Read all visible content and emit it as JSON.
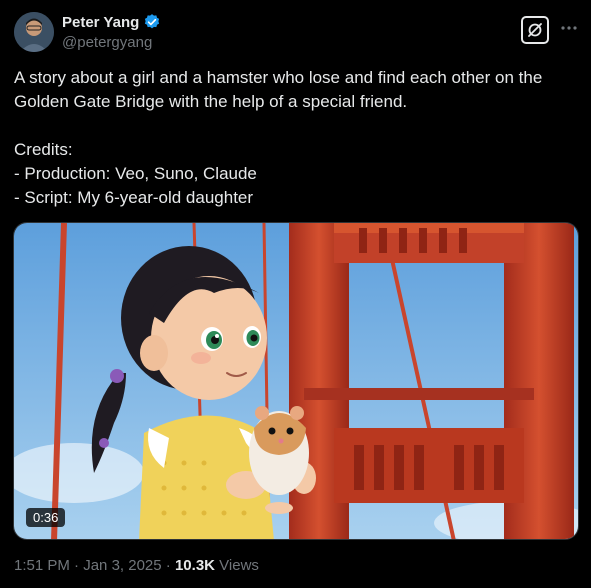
{
  "author": {
    "display_name": "Peter Yang",
    "handle": "@petergyang",
    "verified": true
  },
  "tweet": {
    "line1": "A story about a girl and a hamster who lose and find each other on the Golden Gate Bridge with the help of a special friend.",
    "credits_title": "Credits:",
    "credit_production": "- Production: Veo, Suno, Claude",
    "credit_script": "- Script: My 6-year-old daughter"
  },
  "media": {
    "duration": "0:36",
    "kind": "video"
  },
  "meta": {
    "time": "1:51 PM",
    "sep1": " · ",
    "date": "Jan 3, 2025",
    "sep2": " · ",
    "views_count": "10.3K",
    "views_label": " Views"
  },
  "icons": {
    "grok": "grok-icon",
    "more": "more-icon",
    "verified": "verified-badge-icon"
  },
  "colors": {
    "background": "#000000",
    "text": "#e7e9ea",
    "muted": "#71767b",
    "verified_blue": "#1d9bf0",
    "bridge_red": "#c8412a"
  }
}
